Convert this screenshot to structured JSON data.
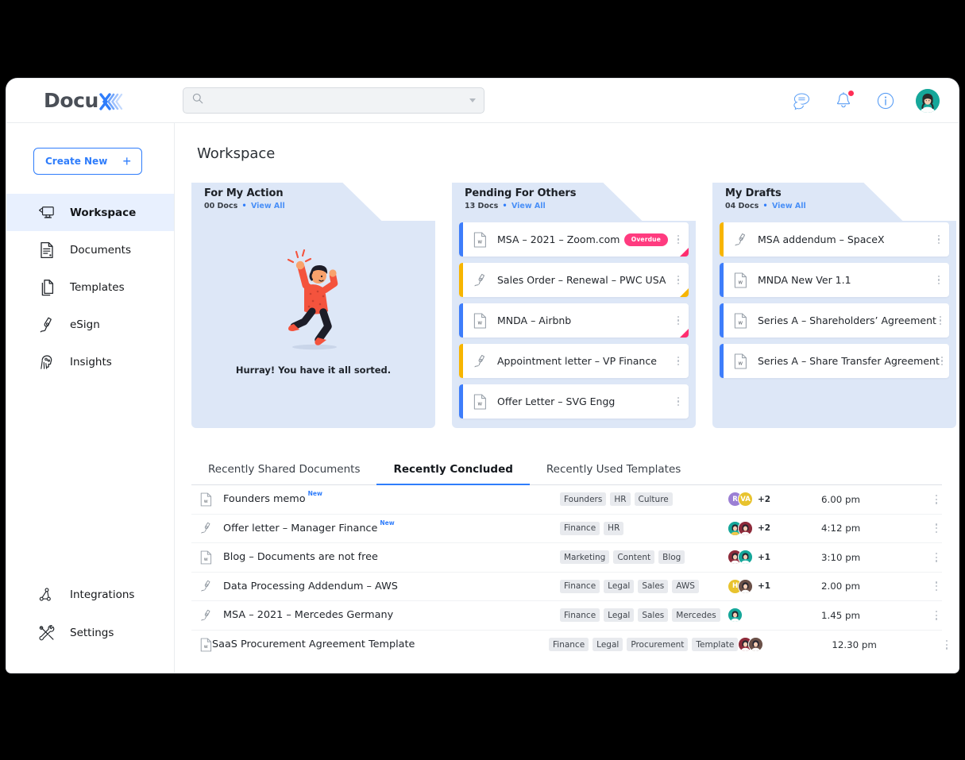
{
  "brand": {
    "name_dark": "Docu",
    "name_accent": "X",
    "accent_color": "#2f7dfb"
  },
  "search": {
    "value": "",
    "placeholder": ""
  },
  "topbar": {
    "icons": [
      {
        "name": "chat-icon",
        "label": "Messages"
      },
      {
        "name": "bell-icon",
        "label": "Notifications"
      },
      {
        "name": "info-icon",
        "label": "Help"
      },
      {
        "name": "avatar",
        "label": "Account"
      }
    ]
  },
  "sidebar": {
    "create_new": {
      "label": "Create New",
      "plus": "+"
    },
    "items": [
      {
        "label": "Workspace",
        "icon": "workspace-icon",
        "active": true
      },
      {
        "label": "Documents",
        "icon": "documents-icon",
        "active": false
      },
      {
        "label": "Templates",
        "icon": "templates-icon",
        "active": false
      },
      {
        "label": "eSign",
        "icon": "esign-icon",
        "active": false
      },
      {
        "label": "Insights",
        "icon": "insights-icon",
        "active": false
      }
    ],
    "bottom_items": [
      {
        "label": "Integrations",
        "icon": "integrations-icon"
      },
      {
        "label": "Settings",
        "icon": "settings-icon"
      }
    ]
  },
  "main": {
    "page_title": "Workspace",
    "cards": [
      {
        "title": "For My Action",
        "count": "00 Docs",
        "separator": "•",
        "view_all": "View All",
        "empty": true,
        "empty_text": "Hurray! You have it all sorted.",
        "rows": []
      },
      {
        "title": "Pending For Others",
        "count": "13 Docs",
        "separator": "•",
        "view_all": "View All",
        "empty": false,
        "rows": [
          {
            "name": "MSA – 2021 – Zoom.com",
            "icon": "word-doc-icon",
            "bar": "blue",
            "badge": "Overdue",
            "corner": "pink"
          },
          {
            "name": "Sales Order – Renewal – PWC USA",
            "icon": "esign-doc-icon",
            "bar": "amber",
            "badge": "",
            "corner": "amber"
          },
          {
            "name": "MNDA – Airbnb",
            "icon": "word-doc-icon",
            "bar": "blue",
            "badge": "",
            "corner": "pink"
          },
          {
            "name": "Appointment letter – VP Finance",
            "icon": "esign-doc-icon",
            "bar": "amber",
            "badge": "",
            "corner": ""
          },
          {
            "name": "Offer Letter – SVG Engg",
            "icon": "word-doc-icon",
            "bar": "blue",
            "badge": "",
            "corner": ""
          }
        ]
      },
      {
        "title": "My Drafts",
        "count": "04 Docs",
        "separator": "•",
        "view_all": "View All",
        "empty": false,
        "rows": [
          {
            "name": "MSA addendum – SpaceX",
            "icon": "esign-doc-icon",
            "bar": "amber",
            "badge": "",
            "corner": ""
          },
          {
            "name": "MNDA New Ver 1.1",
            "icon": "word-doc-icon",
            "bar": "blue",
            "badge": "",
            "corner": ""
          },
          {
            "name": "Series A – Shareholders’ Agreement",
            "icon": "word-doc-icon",
            "bar": "blue",
            "badge": "",
            "corner": ""
          },
          {
            "name": "Series A – Share Transfer Agreement",
            "icon": "word-doc-icon",
            "bar": "blue",
            "badge": "",
            "corner": ""
          }
        ]
      }
    ],
    "tabs": [
      {
        "label": "Recently Shared Documents",
        "active": false
      },
      {
        "label": "Recently Concluded",
        "active": true
      },
      {
        "label": "Recently Used Templates",
        "active": false
      }
    ],
    "table_rows": [
      {
        "icon": "word-doc-icon",
        "name": "Founders memo",
        "new_badge": "New",
        "tags": [
          "Founders",
          "HR",
          "Culture"
        ],
        "avatars": [
          {
            "type": "initials",
            "text": "R",
            "color": "#9b7fd4"
          },
          {
            "type": "initials",
            "text": "VA",
            "color": "#e8c32e"
          }
        ],
        "more": "+2",
        "time": "6.00 pm"
      },
      {
        "icon": "esign-doc-icon",
        "name": "Offer letter – Manager Finance",
        "new_badge": "New",
        "tags": [
          "Finance",
          "HR"
        ],
        "avatars": [
          {
            "type": "photo",
            "text": "",
            "color": "#16a79a"
          },
          {
            "type": "photo",
            "text": "",
            "color": "#8e2b3b"
          }
        ],
        "more": "+2",
        "time": "4:12 pm"
      },
      {
        "icon": "word-doc-icon",
        "name": "Blog – Documents are not free",
        "new_badge": "",
        "tags": [
          "Marketing",
          "Content",
          "Blog"
        ],
        "avatars": [
          {
            "type": "photo",
            "text": "",
            "color": "#8e2b3b"
          },
          {
            "type": "photo",
            "text": "",
            "color": "#16a79a"
          }
        ],
        "more": "+1",
        "time": "3:10 pm"
      },
      {
        "icon": "esign-doc-icon",
        "name": "Data Processing Addendum – AWS",
        "new_badge": "",
        "tags": [
          "Finance",
          "Legal",
          "Sales",
          "AWS"
        ],
        "avatars": [
          {
            "type": "initials",
            "text": "H",
            "color": "#e8c32e"
          },
          {
            "type": "photo",
            "text": "",
            "color": "#6b5149"
          }
        ],
        "more": "+1",
        "time": "2.00 pm"
      },
      {
        "icon": "esign-doc-icon",
        "name": "MSA – 2021 – Mercedes Germany",
        "new_badge": "",
        "tags": [
          "Finance",
          "Legal",
          "Sales",
          "Mercedes"
        ],
        "avatars": [
          {
            "type": "photo",
            "text": "",
            "color": "#16a79a"
          }
        ],
        "more": "",
        "time": "1.45 pm"
      },
      {
        "icon": "word-doc-icon",
        "name": "SaaS Procurement Agreement Template",
        "new_badge": "",
        "tags": [
          "Finance",
          "Legal",
          "Procurement",
          "Template"
        ],
        "avatars": [
          {
            "type": "photo",
            "text": "",
            "color": "#8e2b3b"
          },
          {
            "type": "photo",
            "text": "",
            "color": "#6b5149"
          }
        ],
        "more": "",
        "time": "12.30 pm"
      }
    ]
  }
}
